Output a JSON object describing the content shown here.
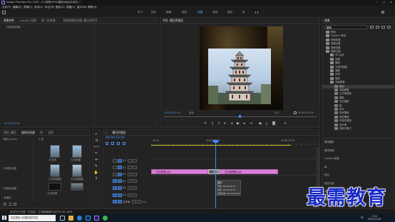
{
  "app": {
    "title": "Adobe Premiere Pro 2020 - D:\\视频\\9950\\翻页动画(未命名) *",
    "menu": [
      "文件(F)",
      "编辑(E)",
      "剪辑(C)",
      "序列(S)",
      "标记(M)",
      "图形(G)",
      "视图(V)",
      "窗口(W)",
      "帮助(H)"
    ],
    "workspaces": [
      "学习",
      "组件",
      "编辑",
      "颜色",
      "效果",
      "音频",
      "图形",
      "库"
    ],
    "active_workspace": "效果",
    "window_controls": [
      "−",
      "□",
      "×"
    ]
  },
  "source_panel": {
    "tabs": [
      "效果控件",
      "Lumetri 范围",
      "源（无剪辑）",
      "音频剪辑混合器: 最后的序列"
    ],
    "subheader": "（未选择剪辑）",
    "timecode": "00:00:00:00"
  },
  "program_monitor": {
    "title": "节目: 最后的图层",
    "timecode_left": "00:00:00:00",
    "fit": "适合",
    "quality": "1/2",
    "timecode_right": "00:00:10:00",
    "buttons": [
      "marker",
      "in",
      "out",
      "go-in",
      "step-back",
      "play",
      "step-fwd",
      "go-out",
      "insert",
      "overwrite",
      "export-frame",
      "add",
      "settings"
    ]
  },
  "effects_panel": {
    "title": "效果",
    "search": "翻转",
    "tree": [
      {
        "label": "预设",
        "depth": 0
      },
      {
        "label": "Lumetri 预设",
        "depth": 0
      },
      {
        "label": "音频效果",
        "depth": 0
      },
      {
        "label": "音频过渡",
        "depth": 0
      },
      {
        "label": "视频效果",
        "depth": 0
      },
      {
        "label": "视频过渡",
        "depth": 0
      },
      {
        "label": "3D 运动",
        "depth": 1
      },
      {
        "label": "划像",
        "depth": 1
      },
      {
        "label": "擦除",
        "depth": 1
      },
      {
        "label": "沉浸式视频",
        "depth": 1
      },
      {
        "label": "溶解",
        "depth": 1
      },
      {
        "label": "内滑",
        "depth": 1
      },
      {
        "label": "缩放",
        "depth": 1
      },
      {
        "label": "页面剥落",
        "depth": 1
      },
      {
        "label": "翻页",
        "depth": 2,
        "selected": true
      },
      {
        "label": "页面剥落",
        "depth": 2
      },
      {
        "label": "立方体旋转",
        "depth": 2
      },
      {
        "label": "翻转",
        "depth": 2
      },
      {
        "label": "交叉缩放",
        "depth": 2
      },
      {
        "label": "推",
        "depth": 2
      },
      {
        "label": "拆分",
        "depth": 2
      },
      {
        "label": "带状擦除",
        "depth": 2
      },
      {
        "label": "渐变擦除",
        "depth": 2
      },
      {
        "label": "时钟式擦除",
        "depth": 2
      },
      {
        "label": "百叶窗",
        "depth": 2
      },
      {
        "label": "双侧平推门",
        "depth": 2
      }
    ],
    "lower_items": [
      "基本图形",
      "基本声音",
      "Lumetri 颜色",
      "库",
      "标记",
      "历史记录",
      "信息",
      "节目: 最后的"
    ]
  },
  "project_panel": {
    "tabs": [
      "项目: 翻页",
      "媒体浏览器",
      "库",
      "信息"
    ],
    "path": "翻页 prproj",
    "item_count": "4 项",
    "folder_label": "本地驱动器",
    "labels_left": [
      "本地驱动器",
      "网络驱动器",
      "收藏夹"
    ],
    "media": [
      {
        "name": "文档",
        "label": "五光塔"
      },
      {
        "name": "五光塔图",
        "label": "五光塔图"
      },
      {
        "name": "五光塔图2",
        "label": "五光塔翻图"
      },
      {
        "name": "五光塔图3",
        "label": "五光塔翻图"
      },
      {
        "name": "五光塔黑",
        "label": "五光塔黑"
      },
      {
        "name": "五光塔",
        "label": "五光塔"
      }
    ],
    "status": "双击打开元素，在拖放，并调整编辑片段打开 Bin 序列"
  },
  "tools": [
    "selection",
    "track-select",
    "ripple",
    "razor",
    "slip",
    "pen",
    "hand",
    "type"
  ],
  "timeline": {
    "tab": "最后的图层",
    "timecode": "00:00:03:00",
    "ruler": [
      "00:00",
      "00:00:05:00",
      "00:00:10:00"
    ],
    "tracks": [
      {
        "name": "V3",
        "type": "video"
      },
      {
        "name": "V2",
        "type": "video"
      },
      {
        "name": "V1",
        "type": "video"
      },
      {
        "name": "A1",
        "type": "audio"
      },
      {
        "name": "A2",
        "type": "audio"
      },
      {
        "name": "A3",
        "type": "audio"
      },
      {
        "name": "主声道",
        "type": "master",
        "value": "0.0"
      }
    ],
    "clips": [
      {
        "label": "五光塔黑.jpg",
        "color": "#d77fd5"
      },
      {
        "label": "翻页",
        "color": "#7a7a7a"
      },
      {
        "label": "五光塔黑图.jpg",
        "color": "#d77fd5"
      }
    ],
    "tooltip": {
      "title": "翻页",
      "lines": [
        "开始: 00:00:02:15",
        "结束: 00:00:03:11",
        "持续时间: 00:00:01:00"
      ]
    }
  },
  "taskbar": {
    "search_placeholder": "在这里输入你要搜索的内容",
    "time": "9:11",
    "date": "2021/11/15",
    "lang": "中"
  },
  "watermark": {
    "text": "最需教育",
    "color": "#1a2ac8"
  }
}
